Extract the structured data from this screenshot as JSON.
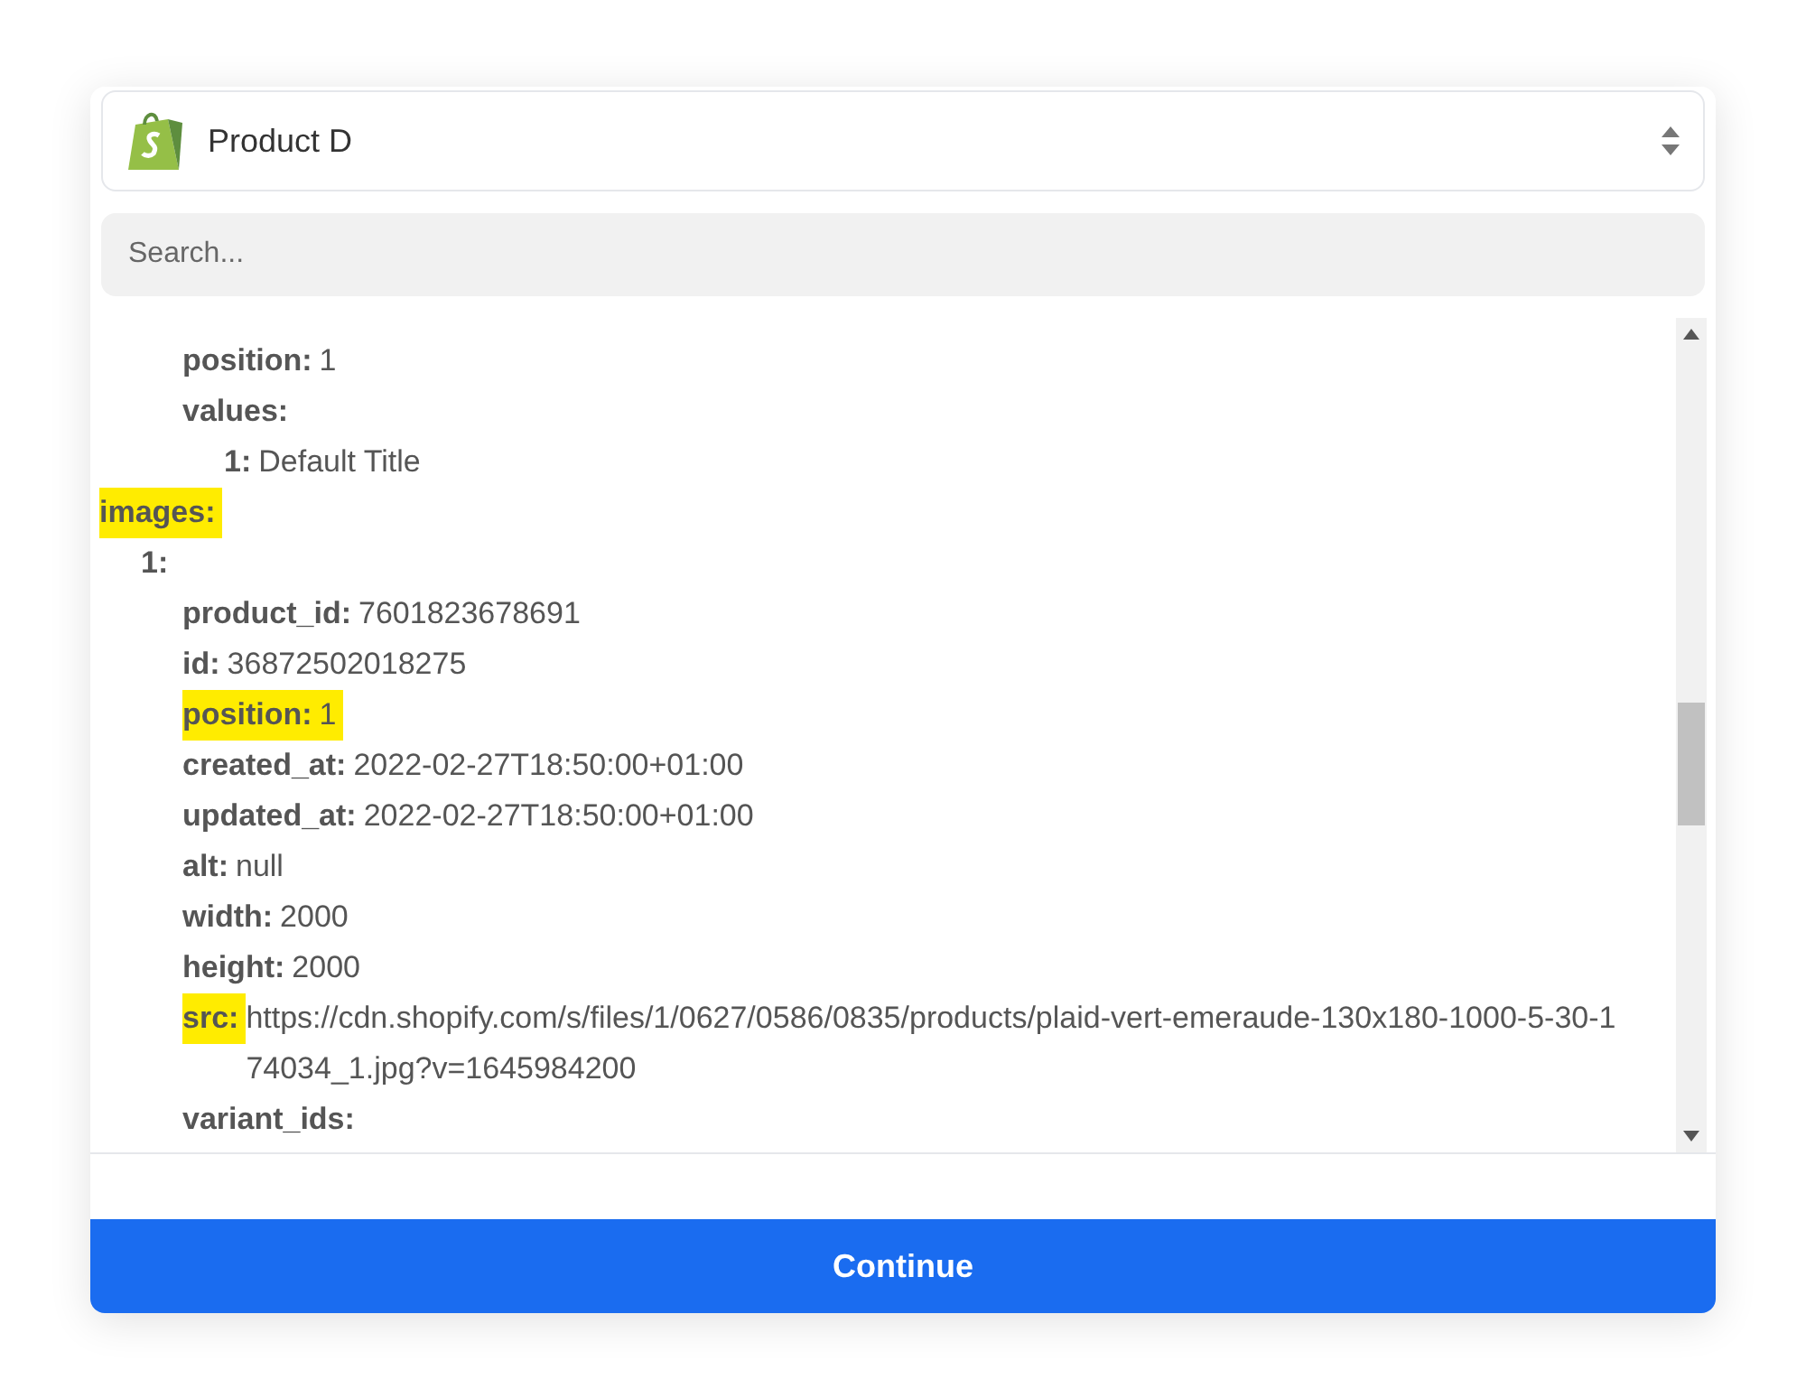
{
  "select": {
    "value": "Product D"
  },
  "search": {
    "placeholder": "Search..."
  },
  "tree": [
    {
      "children": [
        {
          "children": [
            {
              "key": "position:",
              "value": "1",
              "highlighted": false
            },
            {
              "key": "values:",
              "highlighted": false,
              "children": [
                {
                  "key": "1:",
                  "value": "Default Title",
                  "highlighted": false
                }
              ]
            }
          ]
        }
      ]
    },
    {
      "key": "images:",
      "highlighted": true,
      "children": [
        {
          "key": "1:",
          "highlighted": false,
          "children": [
            {
              "key": "product_id:",
              "value": "7601823678691",
              "highlighted": false
            },
            {
              "key": "id:",
              "value": "36872502018275",
              "highlighted": false
            },
            {
              "key": "position:",
              "value": "1",
              "highlighted": true,
              "value_highlighted": true
            },
            {
              "key": "created_at:",
              "value": "2022-02-27T18:50:00+01:00",
              "highlighted": false
            },
            {
              "key": "updated_at:",
              "value": "2022-02-27T18:50:00+01:00",
              "highlighted": false
            },
            {
              "key": "alt:",
              "value": "null",
              "highlighted": false
            },
            {
              "key": "width:",
              "value": "2000",
              "highlighted": false
            },
            {
              "key": "height:",
              "value": "2000",
              "highlighted": false
            },
            {
              "key": "src:",
              "value": "https://cdn.shopify.com/s/files/1/0627/0586/0835/products/plaid-vert-emeraude-130x180-1000-5-30-174034_1.jpg?v=1645984200",
              "highlighted": true
            },
            {
              "key": "variant_ids:",
              "highlighted": false
            }
          ]
        }
      ]
    }
  ],
  "continue_button": "Continue"
}
